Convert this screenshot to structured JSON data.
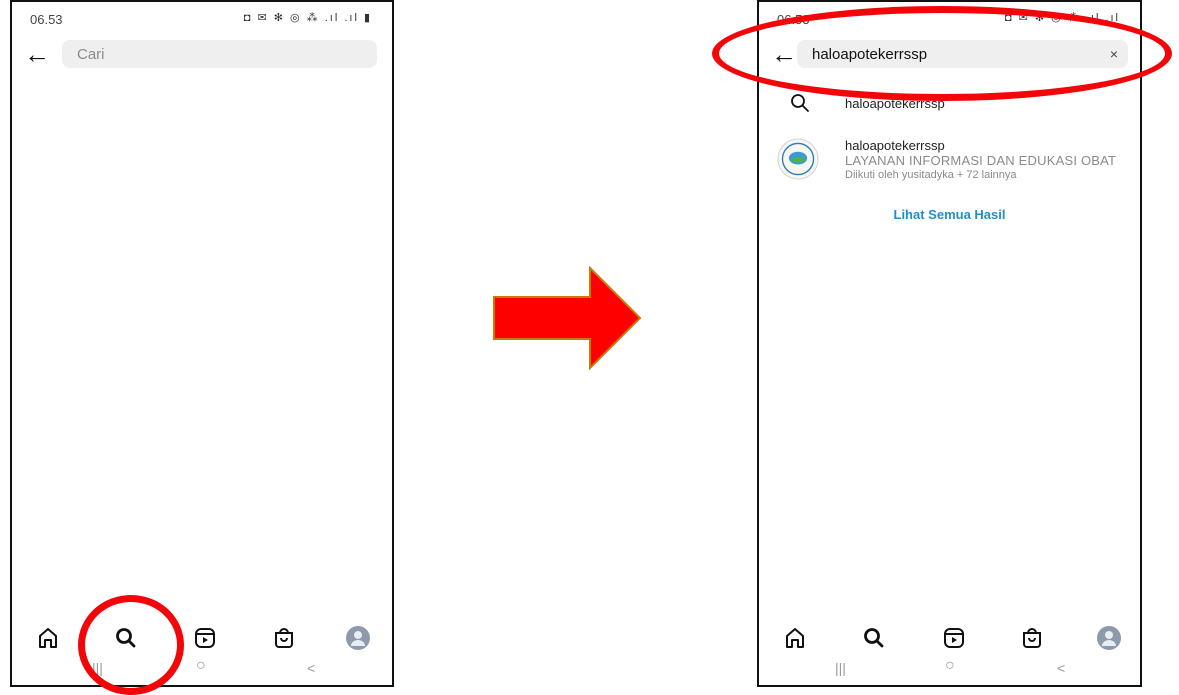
{
  "left_screen": {
    "status_time": "06.53",
    "status_icons": "◘ ✉ ✻ ◎ ⁂ .ıl .ıl ▮",
    "search_placeholder": "Cari",
    "system_nav": [
      "|||",
      "○",
      "<"
    ]
  },
  "right_screen": {
    "status_time": "06.53",
    "status_icons": "◘ ✉ ✻ ◎ ⁂ .ıl .ıl",
    "search_value": "haloapotekerrssp",
    "clear_label": "×",
    "suggestion_query": "haloapotekerrssp",
    "account": {
      "username": "haloapotekerrssp",
      "full_name": "LAYANAN INFORMASI DAN EDUKASI OBAT",
      "followed_by": "Diikuti oleh yusitadyka + 72 lainnya"
    },
    "see_all_label": "Lihat Semua Hasil",
    "system_nav": [
      "|||",
      "○",
      "<"
    ]
  },
  "icons": [
    "back-arrow-icon",
    "home-icon",
    "search-icon",
    "reels-icon",
    "shop-icon",
    "profile-avatar",
    "clear-icon"
  ],
  "colors": {
    "accent_link": "#1f8fc8",
    "highlight_red": "#f2060a",
    "arrow_red": "#ff0000",
    "arrow_outline": "#c87a00",
    "search_field_bg": "#efefef"
  }
}
